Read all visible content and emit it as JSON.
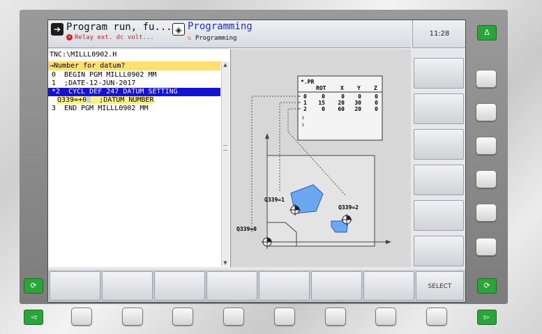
{
  "header": {
    "mode_primary_title": "Program run, fu...",
    "mode_primary_error": "Relay ext. dc volt...",
    "mode_secondary_title": "Programming",
    "mode_secondary_sub": "Programming",
    "clock": "11:28"
  },
  "program": {
    "path": "TNC:\\MILLL0902.H",
    "prompt": "→Number for datum?",
    "lines": [
      {
        "text": "0  BEGIN PGM MILLL0902 MM"
      },
      {
        "text": "1  ;DATE-12-JUN-2017"
      },
      {
        "text": "*2  CYCL DEF 247 DATUM SETTING"
      },
      {
        "text_a": "Q339=+0",
        "text_b": "  ;DATUM NUMBER"
      },
      {
        "text": "3  END PGM MILLL0902 MM"
      }
    ]
  },
  "graphic": {
    "table_name": "*.PR",
    "table_headers": [
      "ROT",
      "X",
      "Y",
      "Z"
    ],
    "table_rows": [
      [
        "0",
        "0",
        "0",
        "0",
        "0"
      ],
      [
        "1",
        "15",
        "20",
        "30",
        "0"
      ],
      [
        "2",
        "0",
        "60",
        "20",
        "0"
      ]
    ],
    "table_more": ":",
    "label_q1": "Q339=1",
    "label_q2": "Q339=2",
    "label_q0": "Q339=0"
  },
  "softkeys": {
    "bottom_select": "SELECT"
  },
  "keys": {
    "delta_key": "Δ",
    "left_key": "◅",
    "right_key": "▻",
    "cycle_key": "⟳"
  },
  "colors": {
    "selection": "#1313d8",
    "prompt": "#ffe070",
    "workpiece_blue": "#6aa8f2",
    "green_key": "#2aa53a"
  }
}
